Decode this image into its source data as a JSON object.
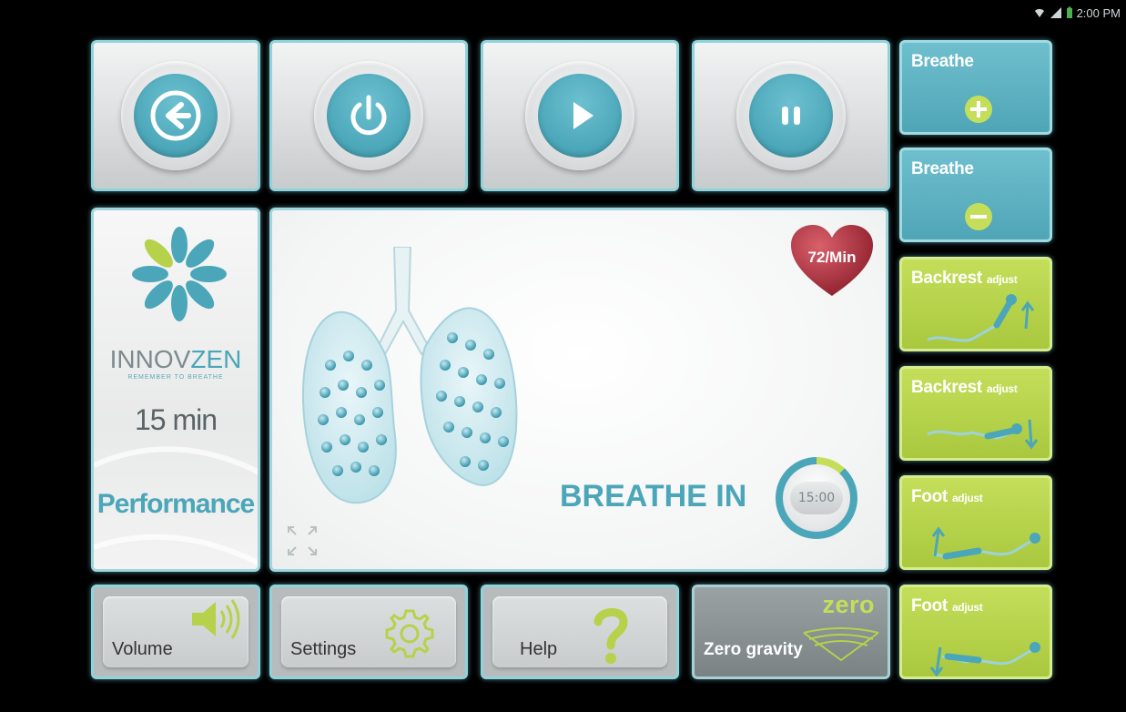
{
  "status_bar": {
    "time": "2:00 PM"
  },
  "top_controls": [
    {
      "name": "back-button",
      "icon": "arrow-left-icon"
    },
    {
      "name": "power-button",
      "icon": "power-icon"
    },
    {
      "name": "play-button",
      "icon": "play-icon"
    },
    {
      "name": "pause-button",
      "icon": "pause-icon"
    }
  ],
  "brand": {
    "name_part1": "INNOV",
    "name_part2": "ZEN",
    "tagline": "REMEMBER TO BREATHE",
    "duration": "15 min",
    "mode": "Performance"
  },
  "session": {
    "heart_rate": "72/Min",
    "instruction": "BREATHE IN",
    "timer": "15:00"
  },
  "right_controls": {
    "breathe_plus": {
      "label": "Breathe"
    },
    "breathe_minus": {
      "label": "Breathe"
    },
    "backrest_up": {
      "label": "Backrest",
      "suffix": "adjust"
    },
    "backrest_down": {
      "label": "Backrest",
      "suffix": "adjust"
    },
    "foot_up": {
      "label": "Foot",
      "suffix": "adjust"
    },
    "foot_down": {
      "label": "Foot",
      "suffix": "adjust"
    }
  },
  "bottom_controls": {
    "volume": "Volume",
    "settings": "Settings",
    "help": "Help",
    "zero_gravity": "Zero gravity",
    "zero_word": "zero"
  },
  "colors": {
    "teal": "#4aa6b8",
    "lime": "#b5d24a",
    "heart": "#b0313f",
    "border": "#8fd3dc"
  }
}
